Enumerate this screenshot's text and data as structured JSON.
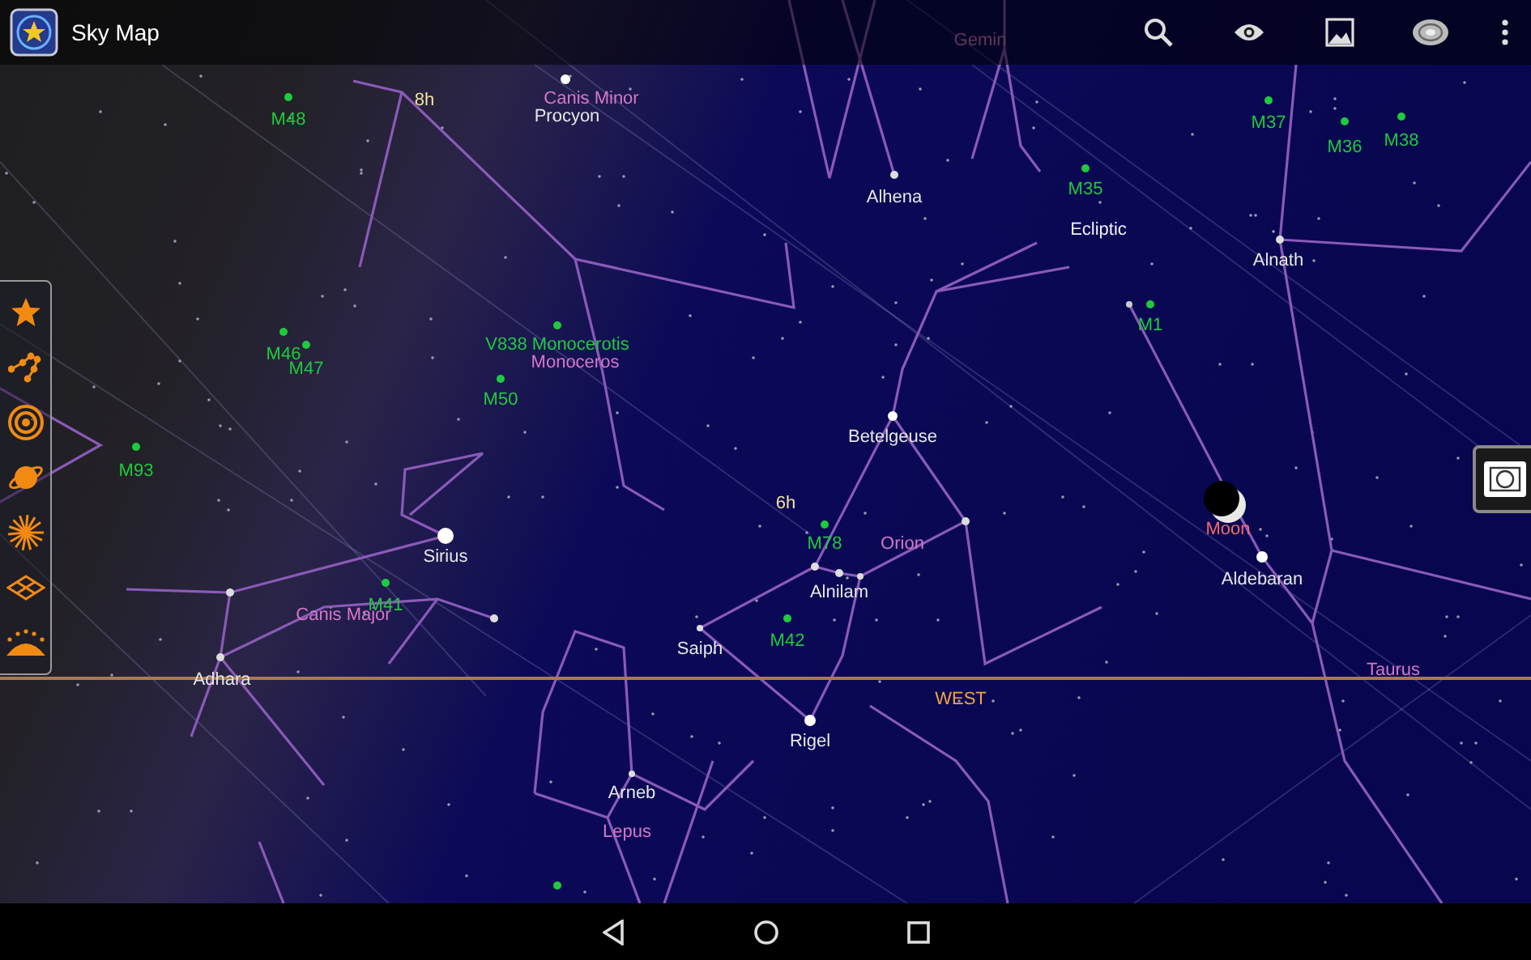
{
  "app_bar": {
    "title": "Sky Map"
  },
  "layers": [
    {
      "kind": "stars",
      "on": true
    },
    {
      "kind": "constellations",
      "on": true
    },
    {
      "kind": "messier",
      "on": true
    },
    {
      "kind": "planets",
      "on": true
    },
    {
      "kind": "meteors",
      "on": true
    },
    {
      "kind": "grid",
      "on": true
    },
    {
      "kind": "horizon",
      "on": true
    }
  ],
  "labels": [
    {
      "text": "Gemin",
      "kind": "constellation"
    },
    {
      "text": "M48",
      "kind": "messier"
    },
    {
      "text": "8h",
      "kind": "grid"
    },
    {
      "text": "Canis Minor",
      "kind": "constellation"
    },
    {
      "text": "Procyon",
      "kind": "star"
    },
    {
      "text": "M37",
      "kind": "messier"
    },
    {
      "text": "M36",
      "kind": "messier"
    },
    {
      "text": "M38",
      "kind": "messier"
    },
    {
      "text": "M35",
      "kind": "messier"
    },
    {
      "text": "Alhena",
      "kind": "star"
    },
    {
      "text": "Ecliptic",
      "kind": "ecliptic"
    },
    {
      "text": "Alnath",
      "kind": "star"
    },
    {
      "text": "M1",
      "kind": "messier"
    },
    {
      "text": "V838 Monocerotis",
      "kind": "messier"
    },
    {
      "text": "M46",
      "kind": "messier"
    },
    {
      "text": "M47",
      "kind": "messier"
    },
    {
      "text": "Monoceros",
      "kind": "constellation"
    },
    {
      "text": "M50",
      "kind": "messier"
    },
    {
      "text": "Betelgeuse",
      "kind": "star"
    },
    {
      "text": "M93",
      "kind": "messier"
    },
    {
      "text": "6h",
      "kind": "grid"
    },
    {
      "text": "Moon",
      "kind": "planet"
    },
    {
      "text": "M78",
      "kind": "messier"
    },
    {
      "text": "Orion",
      "kind": "constellation"
    },
    {
      "text": "Sirius",
      "kind": "star"
    },
    {
      "text": "Aldebaran",
      "kind": "star"
    },
    {
      "text": "Alnilam",
      "kind": "star"
    },
    {
      "text": "M41",
      "kind": "messier"
    },
    {
      "text": "Canis Major",
      "kind": "constellation"
    },
    {
      "text": "M42",
      "kind": "messier"
    },
    {
      "text": "Saiph",
      "kind": "star"
    },
    {
      "text": "Taurus",
      "kind": "constellation"
    },
    {
      "text": "Adhara",
      "kind": "star"
    },
    {
      "text": "WEST",
      "kind": "direction"
    },
    {
      "text": "Rigel",
      "kind": "star"
    },
    {
      "text": "Arneb",
      "kind": "star"
    },
    {
      "text": "Lepus",
      "kind": "constellation"
    }
  ]
}
